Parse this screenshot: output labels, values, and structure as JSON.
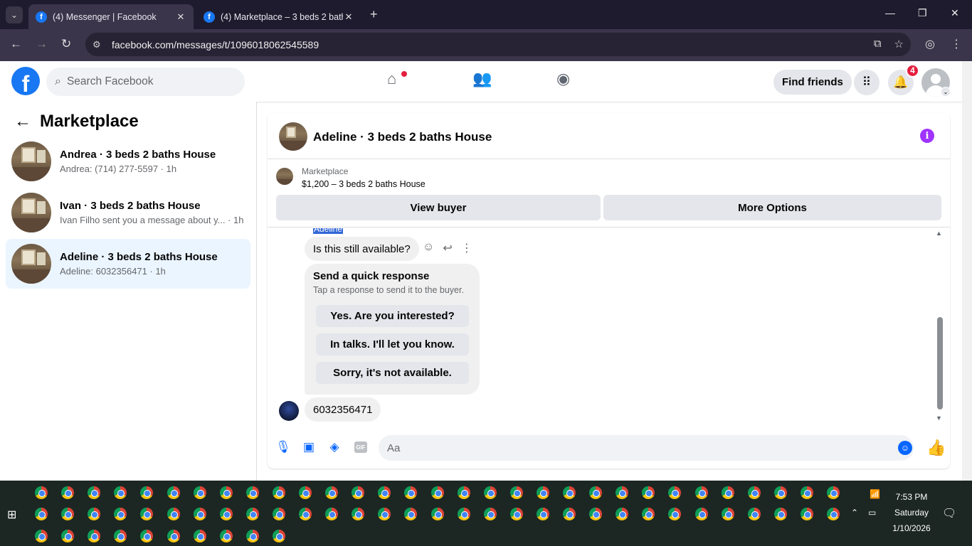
{
  "browser": {
    "tabs": [
      {
        "title": "(4) Messenger | Facebook",
        "active": true
      },
      {
        "title": "(4) Marketplace – 3 beds 2 bath",
        "active": false
      }
    ],
    "url": "facebook.com/messages/t/1096018062545589"
  },
  "fb_header": {
    "search_placeholder": "Search Facebook",
    "find_friends_label": "Find friends",
    "notifications_count": "4"
  },
  "left_panel": {
    "title": "Marketplace",
    "conversations": [
      {
        "name": "Andrea · 3 beds 2 baths House",
        "preview": "Andrea: (714) 277-5597 · 1h",
        "selected": false
      },
      {
        "name": "Ivan · 3 beds 2 baths House",
        "preview": "Ivan Filho sent you a message about y... · 1h",
        "selected": false
      },
      {
        "name": "Adeline · 3 beds 2 baths House",
        "preview": "Adeline: 6032356471 · 1h",
        "selected": true
      }
    ]
  },
  "chat": {
    "title": "Adeline · 3 beds 2 baths House",
    "marketplace_label": "Marketplace",
    "listing": "$1,200 – 3 beds 2 baths House",
    "view_buyer_label": "View buyer",
    "more_options_label": "More Options",
    "sender_name": "Adeline",
    "message_1": "Is this still available?",
    "quick_response": {
      "title": "Send a quick response",
      "subtitle": "Tap a response to send it to the buyer.",
      "options": [
        "Yes. Are you interested?",
        "In talks. I'll let you know.",
        "Sorry, it's not available."
      ]
    },
    "message_2": "6032356471",
    "composer_placeholder": "Aa"
  },
  "taskbar": {
    "time": "7:53 PM",
    "day": "Saturday",
    "date": "1/10/2026"
  },
  "colors": {
    "facebook_blue": "#1877f2",
    "messenger_blue": "#0866ff",
    "selected_bg": "#ebf5ff",
    "info_purple": "#a033ff"
  }
}
